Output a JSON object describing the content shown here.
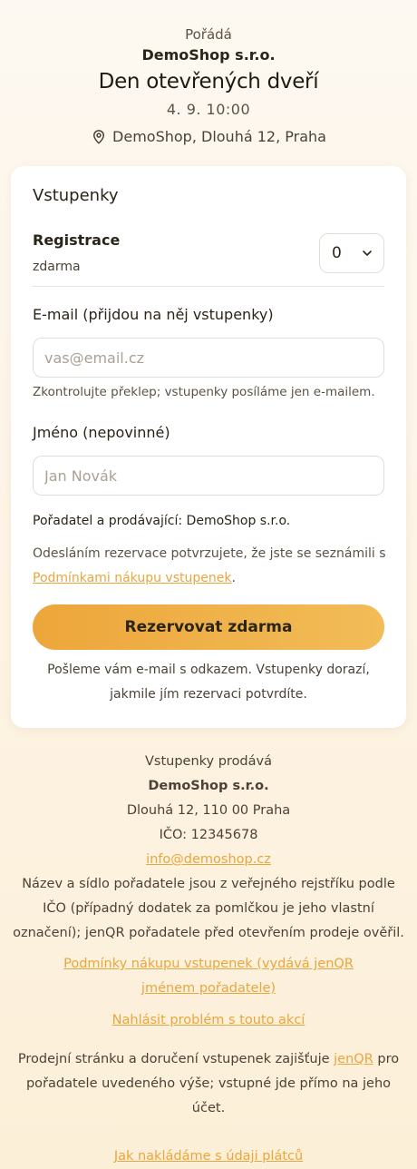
{
  "event": {
    "organizer_label": "Pořádá",
    "organizer_name": "DemoShop s.r.o.",
    "title": "Den otevřených dveří",
    "datetime": "4. 9. 10:00",
    "place": "DemoShop, Dlouhá 12, Praha",
    "place_icon": "map-pin-icon"
  },
  "tickets": {
    "heading": "Vstupenky",
    "items": [
      {
        "name": "Registrace",
        "price": "zdarma",
        "quantity": "0"
      }
    ]
  },
  "form": {
    "email_label": "E-mail (přijdou na něj vstupenky)",
    "email_placeholder": "vas@email.cz",
    "email_value": "",
    "email_hint": "Zkontrolujte překlep; vstupenky posíláme jen e-mailem.",
    "name_label": "Jméno (nepovinné)",
    "name_placeholder": "Jan Novák",
    "name_value": "",
    "seller_line": "Pořadatel a prodávající: DemoShop s.r.o.",
    "consent_before": "Odesláním rezervace potvrzujete, že jste se seznámili s ",
    "consent_link": "Podmínkami nákupu vstupenek",
    "consent_after": ".",
    "submit_label": "Rezervovat zdarma",
    "after_note": "Pošleme vám e-mail s odkazem. Vstupenky dorazí, jakmile jím rezervaci potvrdíte."
  },
  "footer": {
    "sold_by_label": "Vstupenky prodává",
    "seller_name": "DemoShop s.r.o.",
    "address": "Dlouhá 12, 110 00 Praha",
    "ico": "IČO: 12345678",
    "email": "info@demoshop.cz",
    "registry_note": "Název a sídlo pořadatele jsou z veřejného rejstříku podle IČO (případný dodatek za pomlčkou je jeho vlastní označení); jenQR pořadatele před otevřením prodeje ověřil.",
    "terms_link": "Podmínky nákupu vstupenek (vydává jenQR jménem pořadatele)",
    "report_link": "Nahlásit problém s touto akcí",
    "platform_before": "Prodejní stránku a doručení vstupenek zajišťuje ",
    "platform_link": "jenQR",
    "platform_after": " pro pořadatele uvedeného výše; vstupné jde přímo na jeho účet.",
    "privacy_link": "Jak nakládáme s údaji plátců"
  },
  "colors": {
    "accent": "#eda63a",
    "link": "#e9a63c",
    "text": "#2a2419"
  }
}
